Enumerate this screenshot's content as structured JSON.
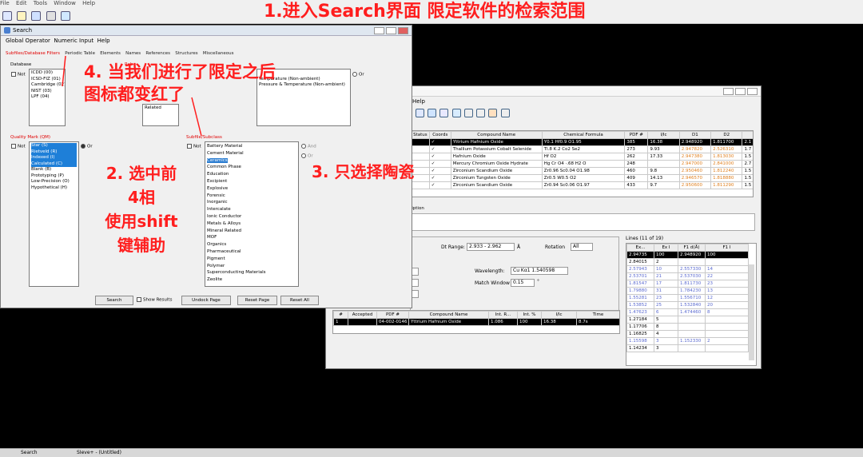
{
  "app": {
    "menu": [
      "File",
      "Edit",
      "Tools",
      "Window",
      "Help"
    ],
    "annotation_top": "1.进入Search界面 限定软件的检索范围"
  },
  "search_window": {
    "title": "Search",
    "menu": [
      "Global Operator",
      "Numeric Input",
      "Help"
    ],
    "tabs": [
      "Subfiles/Database Filters",
      "Periodic Table",
      "Elements",
      "Names",
      "References",
      "Structures",
      "Miscellaneous"
    ],
    "database_label": "Database",
    "not_label": "Not",
    "database_items": [
      "ICDD (00)",
      "ICSD-FIZ (01)",
      "Cambridge (02)",
      "NIST (03)",
      "LPF (04)"
    ],
    "mid_label": "Rel",
    "mid_items": [
      "Related"
    ],
    "ambient_items": [
      "Temperature (Non-ambient)",
      "Pressure & Temperature (Non-ambient)"
    ],
    "or_label": "Or",
    "and_label": "And",
    "quality_label": "Quality Mark (QM)",
    "quality_items": [
      "Star (S)",
      "Rietveld (R)",
      "Indexed (I)",
      "Calculated (C)",
      "Blank (B)",
      "Prototyping (P)",
      "Low-Precision (O)",
      "Hypothetical (H)"
    ],
    "subfile_label": "Subfile/Subclass",
    "subfile_items": [
      "Battery Material",
      "Cement Material",
      "Ceramics",
      "Common Phase",
      "Education",
      "Excipient",
      "Explosive",
      "Forensic",
      "Inorganic",
      "Intercalate",
      "Ionic Conductor",
      "Metals & Alloys",
      "Mineral Related",
      "MOF",
      "Organics",
      "Pharmaceutical",
      "Pigment",
      "Polymer",
      "Superconducting Materials",
      "Zeolite"
    ],
    "buttons": {
      "search": "Search",
      "show_results": "Show Results",
      "undock": "Undock Page",
      "reset_page": "Reset Page",
      "reset_all": "Reset All"
    }
  },
  "results_window": {
    "menu_help": "Help",
    "columns": [
      "Status",
      "Coords",
      "Compound Name",
      "Chemical Formula",
      "PDF #",
      "I/Ic",
      "D1",
      "D2"
    ],
    "rows": [
      {
        "status": "",
        "coords": "✓",
        "name": "Yttrium Hafnium Oxide",
        "formula": "Y0.1 Hf0.9 O1.95",
        "pdf": "385",
        "iic": "16.38",
        "d1": "2.948920",
        "d2": "1.811700",
        "d3": "2.1"
      },
      {
        "status": "",
        "coords": "✓",
        "name": "Thallium Potassium Cobalt Selenide",
        "formula": "Tl.8 K.2 Co2 Se2",
        "pdf": "273",
        "iic": "9.93",
        "d1": "2.947820",
        "d2": "2.526310",
        "d3": "1.7"
      },
      {
        "status": "",
        "coords": "✓",
        "name": "Hafnium Oxide",
        "formula": "Hf O2",
        "pdf": "262",
        "iic": "17.33",
        "d1": "2.947380",
        "d2": "1.813030",
        "d3": "1.5"
      },
      {
        "status": "",
        "coords": "✓",
        "name": "Mercury Chromium Oxide Hydrate",
        "formula": "Hg Cr O4 ·.68 H2 O",
        "pdf": "248",
        "iic": "",
        "d1": "2.947000",
        "d2": "2.841000",
        "d3": "2.7"
      },
      {
        "status": "",
        "coords": "✓",
        "name": "Zirconium Scandium Oxide",
        "formula": "Zr0.96 Sc0.04 O1.98",
        "pdf": "460",
        "iic": "9.8",
        "d1": "2.950460",
        "d2": "1.812240",
        "d3": "1.5"
      },
      {
        "status": "",
        "coords": "✓",
        "name": "Zirconium Tungsten Oxide",
        "formula": "Zr0.5 W0.5 O2",
        "pdf": "409",
        "iic": "14.13",
        "d1": "2.946570",
        "d2": "1.818880",
        "d3": "1.5"
      },
      {
        "status": "",
        "coords": "✓",
        "name": "Zirconium Scandium Oxide",
        "formula": "Zr0.94 Sc0.06 O1.97",
        "pdf": "433",
        "iic": "9.7",
        "d1": "2.950600",
        "d2": "1.811290",
        "d3": "1.5"
      }
    ],
    "description_label": "ription",
    "dt_range_label": "Dt Range:",
    "dt_range_value": "2.933 - 2.962",
    "dt_unit": "Å",
    "rotation_label": "Rotation",
    "rotation_value": "All",
    "wavelength_label": "Wavelength:",
    "wavelength_value": "Cu Kα1 1.540598",
    "match_window_label": "Match Window",
    "match_window_value": "0.15",
    "match_unit": "°",
    "lines_label": "Lines (11 of 19)",
    "lines_columns": [
      "Ex...",
      "Ex I",
      "F1 d(Å)",
      "F1 I"
    ],
    "lines_rows": [
      [
        "2.94735",
        "100",
        "2.948920",
        "100"
      ],
      [
        "2.84015",
        "2",
        "",
        ""
      ],
      [
        "2.57943",
        "10",
        "2.557330",
        "14"
      ],
      [
        "2.53701",
        "21",
        "2.537030",
        "22"
      ],
      [
        "1.81547",
        "17",
        "1.811730",
        "23"
      ],
      [
        "1.79880",
        "31",
        "1.784230",
        "13"
      ],
      [
        "1.55281",
        "23",
        "1.556710",
        "12"
      ],
      [
        "1.53852",
        "25",
        "1.532840",
        "20"
      ],
      [
        "1.47623",
        "6",
        "1.474460",
        "8"
      ],
      [
        "1.27184",
        "5",
        "",
        ""
      ],
      [
        "1.17706",
        "8",
        "",
        ""
      ],
      [
        "1.16825",
        "4",
        "",
        ""
      ],
      [
        "1.15598",
        "3",
        "1.152330",
        "2"
      ],
      [
        "1.14234",
        "3",
        "",
        ""
      ]
    ],
    "accepted_columns": [
      "#",
      "Accepted",
      "PDF #",
      "Compound Name",
      "Int. R...",
      "Int. %",
      "I/Ic",
      "Time"
    ],
    "accepted_rows": [
      {
        "num": "1",
        "accepted": "",
        "pdf": "04-002-0146",
        "name": "Yttrium Hafnium Oxide",
        "intr": "1.086",
        "intp": "100",
        "iic": "16.38",
        "time": "8.7s"
      }
    ]
  },
  "annotations": {
    "a2": [
      "2. 选中前",
      "4相",
      "使用shift",
      "键辅助"
    ],
    "a3": "3. 只选择陶瓷",
    "a4": [
      "4. 当我们进行了限定之后",
      "图标都变红了"
    ]
  },
  "status_bar": {
    "search_tab": "Search",
    "file_tab": "SIeve+ - (Untitled)"
  },
  "colors": {
    "annotation": "#ff1e1e",
    "highlight": "#1e7fd8",
    "red_tab": "#e00000"
  }
}
